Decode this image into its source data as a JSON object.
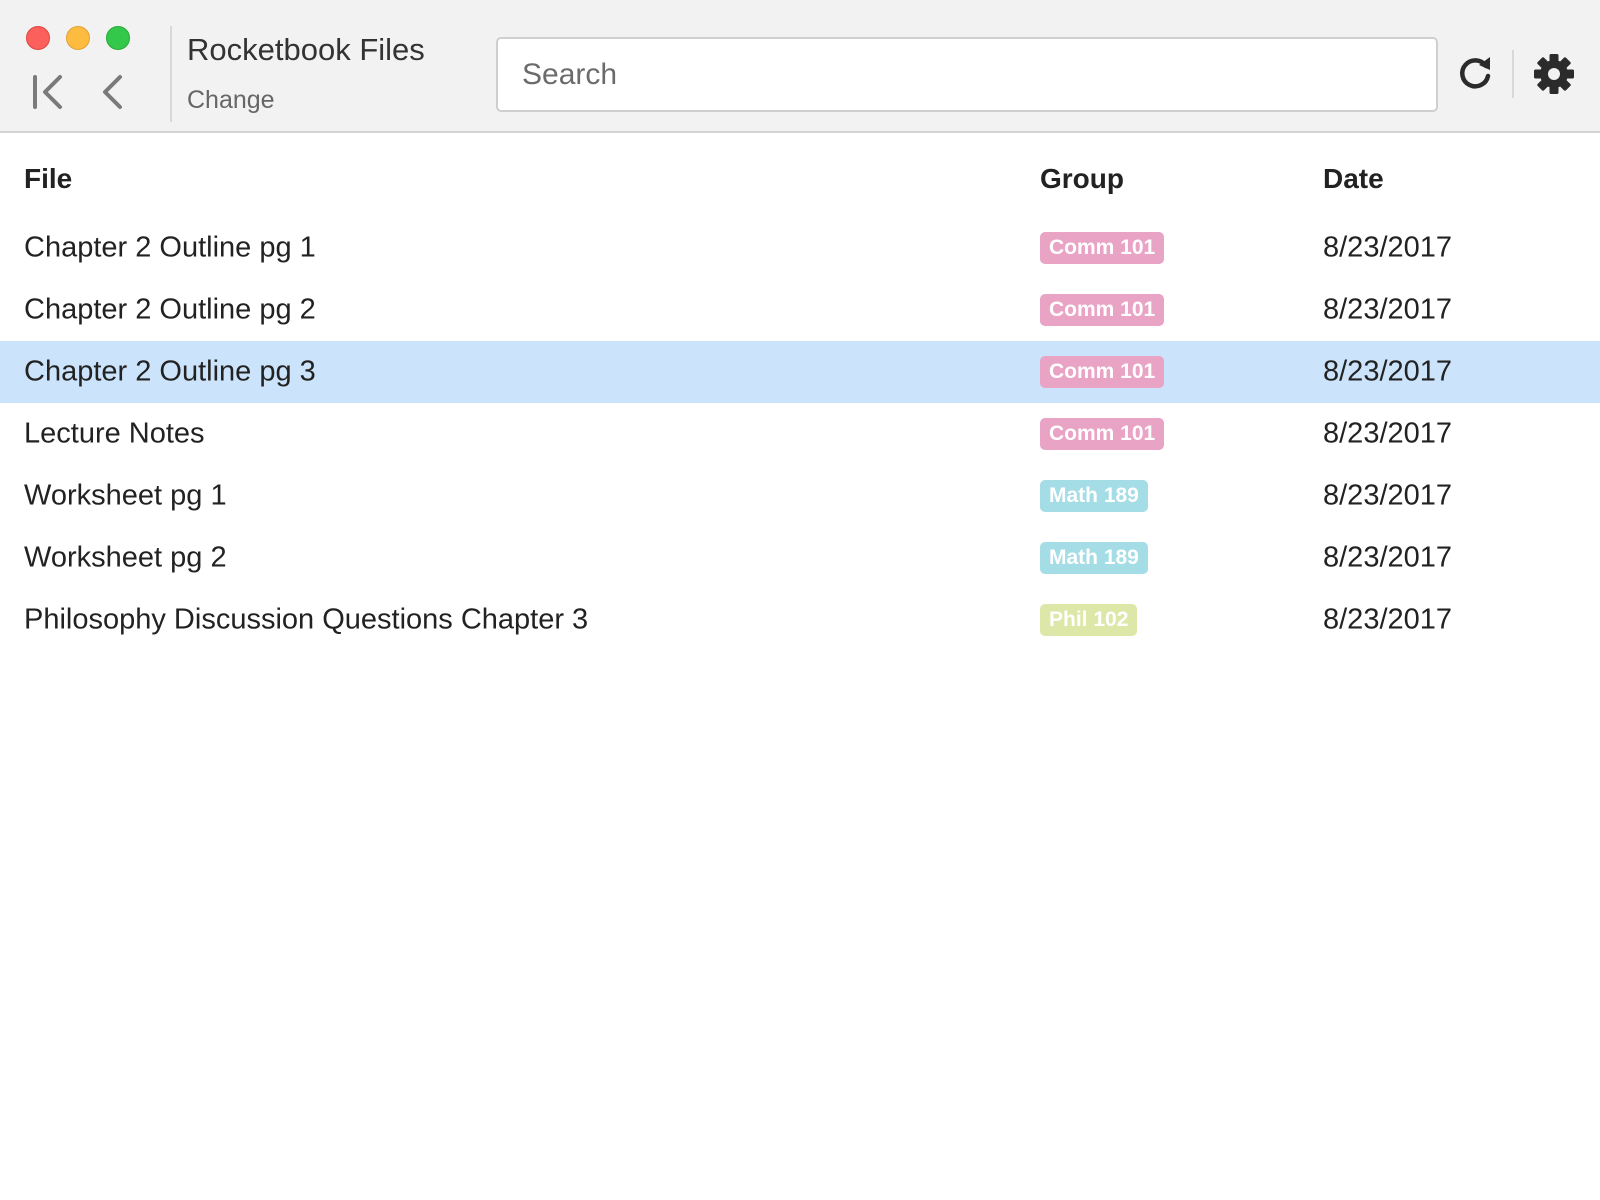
{
  "window": {
    "title": "Rocketbook Files",
    "change_label": "Change"
  },
  "toolbar": {
    "search_placeholder": "Search",
    "search_value": "",
    "first_icon": "first-page-icon",
    "back_icon": "chevron-left-icon",
    "refresh_icon": "refresh-icon",
    "settings_icon": "gear-icon"
  },
  "table": {
    "headers": {
      "file": "File",
      "group": "Group",
      "date": "Date"
    },
    "rows": [
      {
        "file": "Chapter 2 Outline pg 1",
        "group": "Comm 101",
        "group_color": "#e9a3c5",
        "date": "8/23/2017",
        "selected": false
      },
      {
        "file": "Chapter 2 Outline pg 2",
        "group": "Comm 101",
        "group_color": "#e9a3c5",
        "date": "8/23/2017",
        "selected": false
      },
      {
        "file": "Chapter 2 Outline pg 3",
        "group": "Comm 101",
        "group_color": "#e9a3c5",
        "date": "8/23/2017",
        "selected": true
      },
      {
        "file": "Lecture Notes",
        "group": "Comm 101",
        "group_color": "#e9a3c5",
        "date": "8/23/2017",
        "selected": false
      },
      {
        "file": "Worksheet pg 1",
        "group": "Math 189",
        "group_color": "#a5dde6",
        "date": "8/23/2017",
        "selected": false
      },
      {
        "file": "Worksheet pg 2",
        "group": "Math 189",
        "group_color": "#a5dde6",
        "date": "8/23/2017",
        "selected": false
      },
      {
        "file": "Philosophy Discussion Questions Chapter 3",
        "group": "Phil 102",
        "group_color": "#dde8a8",
        "date": "8/23/2017",
        "selected": false
      }
    ]
  },
  "colors": {
    "selected_row": "#cce4fb",
    "titlebar": "#f2f2f2"
  }
}
